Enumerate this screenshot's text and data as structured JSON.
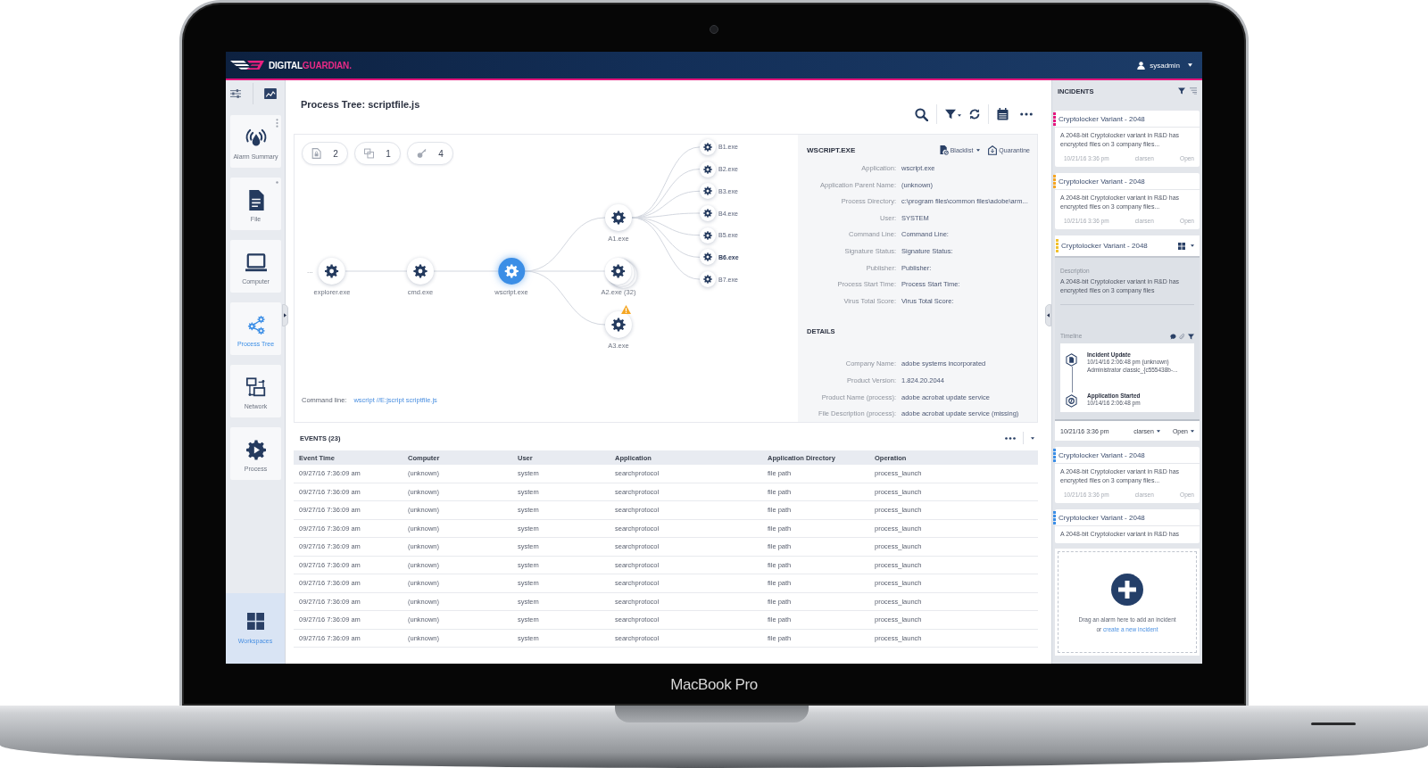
{
  "device": {
    "label": "MacBook Pro"
  },
  "top_bar": {
    "logo": {
      "text": "DIGITAL",
      "accent": "GUARDIAN."
    },
    "user": {
      "name": "sysadmin"
    }
  },
  "sidebar": {
    "tools": [
      {
        "kind": "sliders"
      },
      {
        "kind": "chart"
      }
    ],
    "items": [
      {
        "label": "Alarm Summary",
        "kind": "alarm",
        "selected": false,
        "menu": {
          "kind": "kebab"
        }
      },
      {
        "label": "File",
        "kind": "file",
        "selected": false,
        "menu": {
          "kind": "dot"
        }
      },
      {
        "label": "Computer",
        "kind": "computer",
        "selected": false
      },
      {
        "label": "Process Tree",
        "kind": "process_tree",
        "selected": true
      },
      {
        "label": "Network",
        "kind": "network",
        "selected": false
      },
      {
        "label": "Process",
        "kind": "process",
        "selected": false
      }
    ],
    "workspaces": {
      "label": "Workspaces",
      "selected": true
    }
  },
  "main": {
    "title": "Process Tree: scriptfile.js",
    "toolbar": [
      {
        "kind": "search",
        "dropdown": false
      },
      {
        "kind": "filter",
        "dropdown": true
      },
      {
        "kind": "refresh",
        "dropdown": false
      },
      {
        "kind": "calendar",
        "dropdown": false
      },
      {
        "kind": "more",
        "dropdown": false
      }
    ],
    "tree": {
      "counters": [
        {
          "kind": "file",
          "count": "2"
        },
        {
          "kind": "windows",
          "count": "1"
        },
        {
          "kind": "key",
          "count": "4"
        }
      ],
      "ancestors_marker": "...",
      "root": {
        "name": "explorer.exe",
        "selected": false,
        "warning": false,
        "stacked": false,
        "highlighted": false,
        "children": [
          {
            "name": "cmd.exe",
            "selected": false,
            "warning": false,
            "stacked": false,
            "highlighted": false,
            "children": [
              {
                "name": "wscript.exe",
                "selected": true,
                "warning": false,
                "stacked": false,
                "highlighted": false,
                "children": [
                  {
                    "name": "A1.exe",
                    "selected": false,
                    "warning": false,
                    "stacked": false,
                    "highlighted": false,
                    "children": [
                      {
                        "name": "B1.exe",
                        "selected": false,
                        "warning": false,
                        "stacked": false,
                        "highlighted": false
                      },
                      {
                        "name": "B2.exe",
                        "selected": false,
                        "warning": false,
                        "stacked": false,
                        "highlighted": false
                      },
                      {
                        "name": "B3.exe",
                        "selected": false,
                        "warning": false,
                        "stacked": false,
                        "highlighted": false
                      },
                      {
                        "name": "B4.exe",
                        "selected": false,
                        "warning": false,
                        "stacked": false,
                        "highlighted": false
                      },
                      {
                        "name": "B5.exe",
                        "selected": false,
                        "warning": false,
                        "stacked": false,
                        "highlighted": false
                      },
                      {
                        "name": "B6.exe",
                        "selected": false,
                        "warning": false,
                        "stacked": false,
                        "highlighted": true
                      },
                      {
                        "name": "B7.exe",
                        "selected": false,
                        "warning": false,
                        "stacked": false,
                        "highlighted": false
                      }
                    ]
                  },
                  {
                    "name": "A2.exe (32)",
                    "selected": false,
                    "warning": false,
                    "stacked": true,
                    "highlighted": false
                  },
                  {
                    "name": "A3.exe",
                    "selected": false,
                    "warning": true,
                    "stacked": false,
                    "highlighted": false
                  }
                ]
              }
            ]
          }
        ]
      },
      "command_line": {
        "label": "Command line:",
        "value": "wscript //E:jscript scriptfile.js"
      }
    },
    "details": {
      "title": "WSCRIPT.EXE",
      "actions": [
        {
          "kind": "blacklist",
          "label": "Blacklist",
          "dropdown": true
        },
        {
          "kind": "quarantine",
          "label": "Quarantine",
          "dropdown": false
        }
      ],
      "fields": [
        {
          "label": "Application:",
          "value": "wscript.exe"
        },
        {
          "label": "Application Parent Name:",
          "value": "(unknown)"
        },
        {
          "label": "Process Directory:",
          "value": "c:\\program files\\common files\\adobe\\arm..."
        },
        {
          "label": "User:",
          "value": "SYSTEM"
        },
        {
          "label": "Command Line:",
          "value": "Command Line:"
        },
        {
          "label": "Signature Status:",
          "value": "Signature Status:"
        },
        {
          "label": "Publisher:",
          "value": "Publisher:"
        },
        {
          "label": "Process Start Time:",
          "value": "Process Start Time:"
        },
        {
          "label": "Virus Total Score:",
          "value": "Virus Total Score:"
        }
      ],
      "section": {
        "title": "DETAILS",
        "fields": [
          {
            "label": "Company Name:",
            "value": "adobe systems incorporated"
          },
          {
            "label": "Product Version:",
            "value": "1.824.20.2044"
          },
          {
            "label": "Product Name (process):",
            "value": "adobe acrobat update service"
          },
          {
            "label": "File Description (process):",
            "value": "adobe acrobat update service (missing)"
          }
        ]
      }
    },
    "events": {
      "title": "EVENTS (23)",
      "columns": [
        "Event Time",
        "Computer",
        "User",
        "Application",
        "Application Directory",
        "Operation"
      ],
      "rows": [
        [
          "09/27/16 7:36:09 am",
          "(unknown)",
          "system",
          "searchprotocol",
          "file path",
          "process_launch"
        ],
        [
          "09/27/16 7:36:09 am",
          "(unknown)",
          "system",
          "searchprotocol",
          "file path",
          "process_launch"
        ],
        [
          "09/27/16 7:36:09 am",
          "(unknown)",
          "system",
          "searchprotocol",
          "file path",
          "process_launch"
        ],
        [
          "09/27/16 7:36:09 am",
          "(unknown)",
          "system",
          "searchprotocol",
          "file path",
          "process_launch"
        ],
        [
          "09/27/16 7:36:09 am",
          "(unknown)",
          "system",
          "searchprotocol",
          "file path",
          "process_launch"
        ],
        [
          "09/27/16 7:36:09 am",
          "(unknown)",
          "system",
          "searchprotocol",
          "file path",
          "process_launch"
        ],
        [
          "09/27/16 7:36:09 am",
          "(unknown)",
          "system",
          "searchprotocol",
          "file path",
          "process_launch"
        ],
        [
          "09/27/16 7:36:09 am",
          "(unknown)",
          "system",
          "searchprotocol",
          "file path",
          "process_launch"
        ],
        [
          "09/27/16 7:36:09 am",
          "(unknown)",
          "system",
          "searchprotocol",
          "file path",
          "process_launch"
        ],
        [
          "09/27/16 7:36:09 am",
          "(unknown)",
          "system",
          "searchprotocol",
          "file path",
          "process_launch"
        ]
      ]
    }
  },
  "incidents": {
    "title": "INCIDENTS",
    "list": [
      {
        "title": "Cryptolocker Variant - 2048",
        "color": "#e5177f",
        "expanded": false,
        "description": "A 2048-bit Cryptolocker variant in R&D has encrypted files on 3 company files...",
        "date": "10/21/16 3:36 pm",
        "owner": "clarsen",
        "status": "Open"
      },
      {
        "title": "Cryptolocker Variant - 2048",
        "color": "#f5a623",
        "expanded": false,
        "description": "A 2048-bit Cryptolocker variant in R&D has encrypted files on 3 company files...",
        "date": "10/21/16 3:36 pm",
        "owner": "clarsen",
        "status": "Open"
      },
      {
        "title": "Cryptolocker Variant - 2048",
        "color": "#f2c12e",
        "expanded": true,
        "description_label": "Description",
        "description": "A 2048-bit Cryptolocker variant in R&D has encrypted files on 3 company files",
        "timeline_label": "Timeline",
        "timeline": [
          {
            "kind": "update",
            "title": "Incident Update",
            "lines": [
              "10/14/16 2:06:48 pm (unknown)",
              "Administrator classic_{c555438b-..."
            ]
          },
          {
            "kind": "started",
            "title": "Application Started",
            "lines": [
              "10/14/16 2:06:48 pm"
            ]
          }
        ],
        "date": "10/21/16 3:36 pm",
        "owner": "clarsen",
        "status": "Open"
      },
      {
        "title": "Cryptolocker Variant - 2048",
        "color": "#3b8ee6",
        "expanded": false,
        "description": "A 2048-bit Cryptolocker variant in R&D has encrypted files on 3 company files...",
        "date": "10/21/16 3:36 pm",
        "owner": "clarsen",
        "status": "Open"
      },
      {
        "title": "Cryptolocker Variant - 2048",
        "color": "#3b8ee6",
        "expanded": false,
        "description": "A 2048-bit Cryptolocker variant in R&D has"
      }
    ],
    "dropzone": {
      "text": "Drag an alarm here to add an incident",
      "prefix": "or",
      "link": "create a new incident"
    }
  }
}
